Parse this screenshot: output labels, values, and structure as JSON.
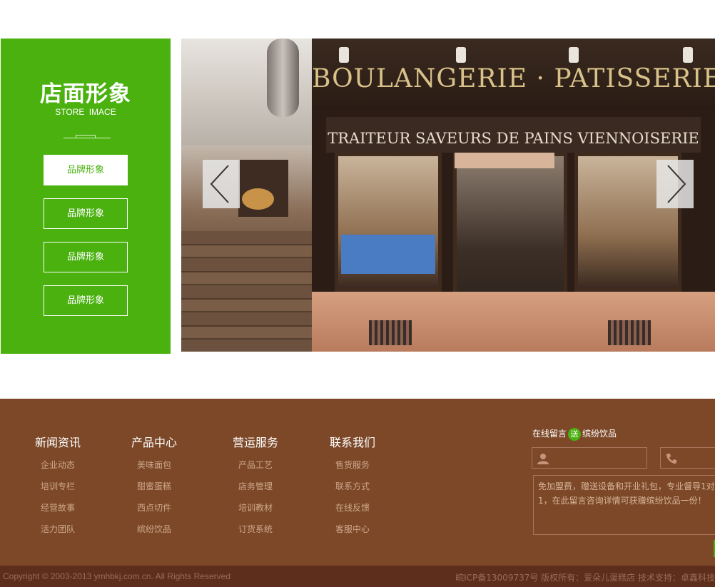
{
  "side": {
    "title": "店面形象",
    "subtitle": "STORE IMACE",
    "buttons": [
      "品牌形象",
      "品牌形象",
      "品牌形象",
      "品牌形象"
    ]
  },
  "slider": {
    "sign_main": "BOULANGERIE · PATISSERIE",
    "sign_sub": "TRAITEUR  SAVEURS DE PAINS  VIENNOISERIE"
  },
  "footer": {
    "columns": [
      {
        "title": "新闻资讯",
        "links": [
          "企业动态",
          "培训专栏",
          "经营故事",
          "活力团队"
        ]
      },
      {
        "title": "产品中心",
        "links": [
          "美味面包",
          "甜蜜蛋糕",
          "西点切件",
          "缤纷饮品"
        ]
      },
      {
        "title": "营运服务",
        "links": [
          "产品工艺",
          "店务管理",
          "培训教材",
          "订货系统"
        ]
      },
      {
        "title": "联系我们",
        "links": [
          "售货服务",
          "联系方式",
          "在线反馈",
          "客服中心"
        ]
      }
    ],
    "message": {
      "head_before": "在线留言",
      "badge": "送",
      "head_after": "缤纷饮品",
      "placeholder": "免加盟费，赠送设备和开业礼包，专业督导1对1，在此留言咨询详情可获赠缤纷饮品一份！"
    },
    "copyright": "Copyright © 2003-2013 ymhbkj.com.cn. All Rights Reserved",
    "icp": "皖ICP备13009737号    版权所有：爱朵儿蛋糕店    技术支持：卓鑫科技"
  },
  "colors": {
    "accent": "#4ab10f",
    "footer_bg": "#7c4828",
    "bottom_bg": "#5e2e1c"
  }
}
